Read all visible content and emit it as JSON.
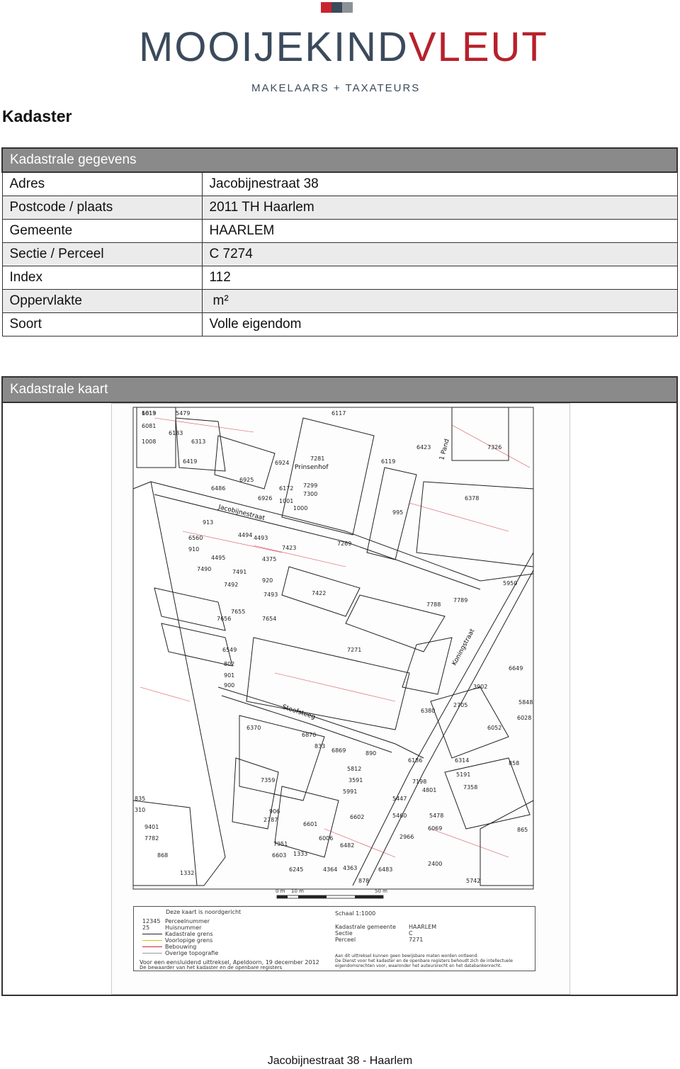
{
  "logo": {
    "part1": "MOOIJEKIND",
    "part2": "VLEUT",
    "subtitle": "MAKELAARS + TAXATEURS",
    "colors": [
      "#c9242d",
      "#3b4a5c",
      "#8d9299"
    ]
  },
  "page_title": "Kadaster",
  "table": {
    "header": "Kadastrale gegevens",
    "rows": [
      {
        "label": "Adres",
        "value": "Jacobijnestraat 38"
      },
      {
        "label": "Postcode / plaats",
        "value": "2011 TH Haarlem"
      },
      {
        "label": "Gemeente",
        "value": "HAARLEM"
      },
      {
        "label": "Sectie / Perceel",
        "value": "C 7274"
      },
      {
        "label": "Index",
        "value": "112"
      },
      {
        "label": "Oppervlakte",
        "value": "m²"
      },
      {
        "label": "Soort",
        "value": "Volle eigendom"
      }
    ]
  },
  "map": {
    "header": "Kadastrale kaart",
    "street_labels": [
      "Jacobijnestraat",
      "Stoofsteeg",
      "Koningstraat",
      "Prinsenhof",
      "1 Pand"
    ],
    "parcel_numbers": [
      "1013",
      "5479",
      "6117",
      "6081",
      "6183",
      "1008",
      "6313",
      "6419",
      "6924",
      "6119",
      "6423",
      "7326",
      "7281",
      "6925",
      "6486",
      "6172",
      "7299",
      "7300",
      "6378",
      "995",
      "6926",
      "1001",
      "1000",
      "913",
      "6560",
      "4494",
      "4493",
      "7423",
      "7269",
      "910",
      "4495",
      "4375",
      "7490",
      "7491",
      "920",
      "7492",
      "7493",
      "7422",
      "5950",
      "7788",
      "7789",
      "7655",
      "7654",
      "7656",
      "6549",
      "7271",
      "802",
      "901",
      "900",
      "3902",
      "2705",
      "5848",
      "6028",
      "6370",
      "6870",
      "6380",
      "6052",
      "6869",
      "890",
      "6314",
      "858",
      "5812",
      "6186",
      "7359",
      "3591",
      "7198",
      "5191",
      "7358",
      "5991",
      "4801",
      "835",
      "310",
      "906",
      "2787",
      "6601",
      "5447",
      "5460",
      "5478",
      "6069",
      "865",
      "9401",
      "7782",
      "2966",
      "6006",
      "6482",
      "2400",
      "868",
      "1332",
      "1333",
      "6245",
      "4364",
      "4363",
      "878",
      "6483",
      "5742",
      "7951",
      "6603",
      "6602",
      "833",
      "6649",
      "6619"
    ],
    "scale": {
      "start": "0 m",
      "mid": "10 m",
      "end": "50 m"
    },
    "legend": {
      "north": "Deze kaart is noordgericht",
      "items": [
        {
          "code": "12345",
          "text": "Perceelnummer"
        },
        {
          "code": "25",
          "text": "Huisnummer"
        },
        {
          "code": "",
          "text": "Kadastrale grens"
        },
        {
          "code": "",
          "text": "Voorlopige grens"
        },
        {
          "code": "",
          "text": "Bebouwing"
        },
        {
          "code": "",
          "text": "Overige topografie"
        }
      ],
      "footnote1": "Voor een eensluidend uittreksel, Apeldoorn, 19 december 2012",
      "footnote2": "De bewaarder van het kadaster en de openbare registers",
      "schaal": "Schaal 1:1000",
      "kg_label": "Kadastrale gemeente",
      "kg_value": "HAARLEM",
      "sectie_label": "Sectie",
      "sectie_value": "C",
      "perceel_label": "Perceel",
      "perceel_value": "7271",
      "disclaimer1": "Aan dit uittreksel kunnen geen bewijsbare maten worden ontleend.",
      "disclaimer2": "De Dienst voor het kadaster en de openbare registers behoudt zich de intellectuele",
      "disclaimer3": "eigendomsrechten voor, waaronder het auteursrecht en het databankenrecht."
    }
  },
  "footer": "Jacobijnestraat 38 - Haarlem"
}
